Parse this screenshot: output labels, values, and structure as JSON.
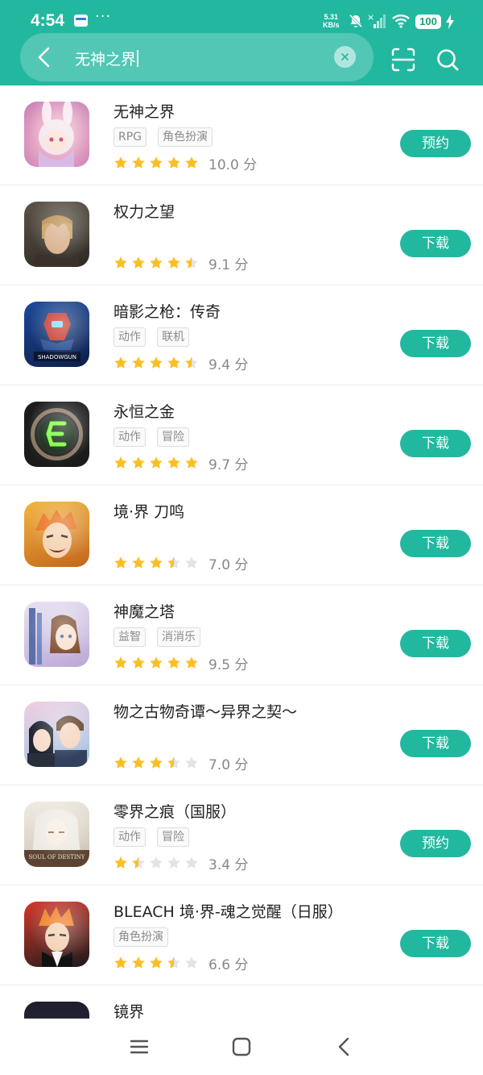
{
  "status_bar": {
    "time": "4:54",
    "dots": "···",
    "speed_value": "5.31",
    "speed_unit": "KB/s",
    "battery": "100"
  },
  "search": {
    "query": "无神之界"
  },
  "colors": {
    "primary": "#22b8a0",
    "star_active": "#fbbe24",
    "star_inactive": "#e3e3e3"
  },
  "results": [
    {
      "name": "无神之界",
      "tags": [
        "RPG",
        "角色扮演"
      ],
      "stars": 5,
      "score": "10.0 分",
      "action": "预约",
      "icon": "anime-girl-bunny-ears-icon"
    },
    {
      "name": "权力之望",
      "tags": [],
      "stars": 4.5,
      "score": "9.1 分",
      "action": "下载",
      "icon": "blonde-warrior-icon"
    },
    {
      "name": "暗影之枪：传奇",
      "tags": [
        "动作",
        "联机"
      ],
      "stars": 4.5,
      "score": "9.4 分",
      "action": "下载",
      "icon": "shadowgun-legends-icon"
    },
    {
      "name": "永恒之金",
      "tags": [
        "动作",
        "冒险"
      ],
      "stars": 5,
      "score": "9.7 分",
      "action": "下载",
      "icon": "green-rune-emblem-icon"
    },
    {
      "name": "境·界 刀鸣",
      "tags": [],
      "stars": 3.5,
      "score": "7.0 分",
      "action": "下载",
      "icon": "orange-hair-swordsman-icon"
    },
    {
      "name": "神魔之塔",
      "tags": [
        "益智",
        "消消乐"
      ],
      "stars": 5,
      "score": "9.5 分",
      "action": "下载",
      "icon": "tower-girl-icon"
    },
    {
      "name": "物之古物奇谭～异界之契～",
      "tags": [],
      "stars": 3.5,
      "score": "7.0 分",
      "action": "下载",
      "icon": "anime-duo-icon"
    },
    {
      "name": "零界之痕（国服）",
      "tags": [
        "动作",
        "冒险"
      ],
      "stars": 1.5,
      "score": "3.4 分",
      "action": "预约",
      "icon": "soul-of-destiny-icon"
    },
    {
      "name": "BLEACH 境·界-魂之觉醒（日服）",
      "tags": [
        "角色扮演"
      ],
      "stars": 3.5,
      "score": "6.6 分",
      "action": "下载",
      "icon": "bleach-ichigo-icon"
    },
    {
      "name": "镜界",
      "tags": [],
      "stars": 0,
      "score": "",
      "action": "",
      "icon": "mirror-realm-icon"
    }
  ]
}
